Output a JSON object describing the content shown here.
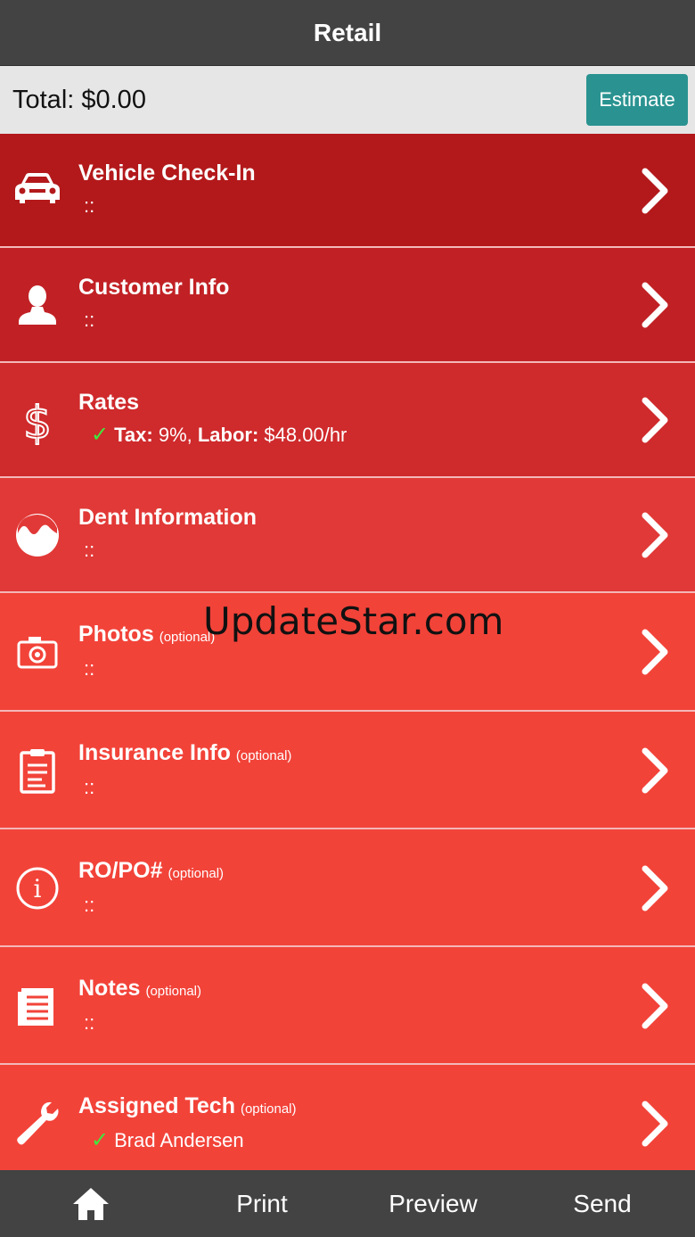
{
  "header": {
    "title": "Retail"
  },
  "totalbar": {
    "total_text": "Total: $0.00",
    "estimate_label": "Estimate"
  },
  "rows": [
    {
      "label": "Vehicle Check-In",
      "optional": "",
      "sub": "::",
      "icon": "car-icon",
      "color": "#b3191b"
    },
    {
      "label": "Customer Info",
      "optional": "",
      "sub": "::",
      "icon": "person-icon",
      "color": "#c12125"
    },
    {
      "label": "Rates",
      "optional": "",
      "sub_check": "✓",
      "sub_tax_label": "Tax:",
      "sub_tax_value": " 9%,",
      "sub_labor_label": " Labor:",
      "sub_labor_value": " $48.00/hr",
      "icon": "dollar-icon",
      "color": "#cf2a2c"
    },
    {
      "label": "Dent Information",
      "optional": "",
      "sub": "::",
      "icon": "dent-icon",
      "color": "#e13937"
    },
    {
      "label": "Photos",
      "optional": "(optional)",
      "sub": "::",
      "icon": "camera-icon",
      "color": "#f24339"
    },
    {
      "label": "Insurance Info",
      "optional": "(optional)",
      "sub": "::",
      "icon": "clipboard-icon",
      "color": "#f24339"
    },
    {
      "label": "RO/PO#",
      "optional": "(optional)",
      "sub": "::",
      "icon": "info-icon",
      "color": "#f24339"
    },
    {
      "label": "Notes",
      "optional": "(optional)",
      "sub": "::",
      "icon": "notes-icon",
      "color": "#f24339"
    },
    {
      "label": "Assigned Tech",
      "optional": "(optional)",
      "sub_check": "✓",
      "sub": "Brad Andersen",
      "icon": "wrench-icon",
      "color": "#f24339"
    }
  ],
  "watermark": "UpdateStar.com",
  "bottom_nav": {
    "home_icon": "home-icon",
    "print": "Print",
    "preview": "Preview",
    "send": "Send"
  }
}
